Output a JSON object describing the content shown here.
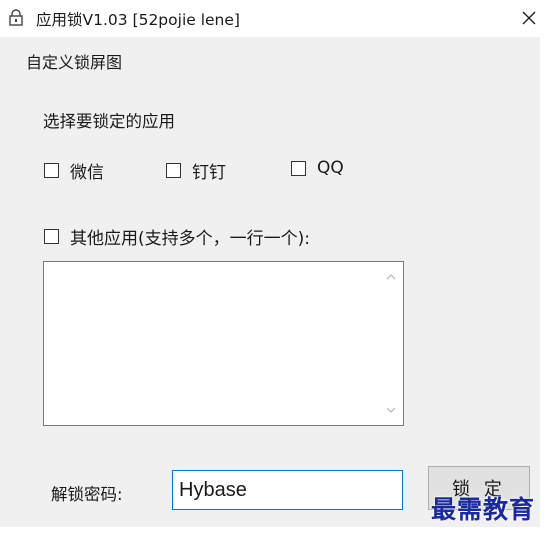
{
  "window": {
    "title": "应用锁V1.03 [52pojie lene]",
    "icon": "app-lock-icon",
    "close_icon": "close-icon"
  },
  "menu": {
    "items": [
      "自定义锁屏图"
    ]
  },
  "form": {
    "section_label": "选择要锁定的应用",
    "apps": [
      {
        "label": "微信",
        "checked": false
      },
      {
        "label": "钉钉",
        "checked": false
      },
      {
        "label": "QQ",
        "checked": false
      }
    ],
    "other_apps": {
      "label": "其他应用(支持多个，一行一个):",
      "checked": false,
      "value": ""
    },
    "password_label": "解锁密码:",
    "password_value": "Hybase",
    "lock_button": "锁 定"
  },
  "watermark": "最需教育",
  "colors": {
    "client_bg": "#f0f0f0",
    "focus_border": "#0078d7",
    "button_bg": "#e1e1e1",
    "watermark": "#1a2a9a"
  }
}
